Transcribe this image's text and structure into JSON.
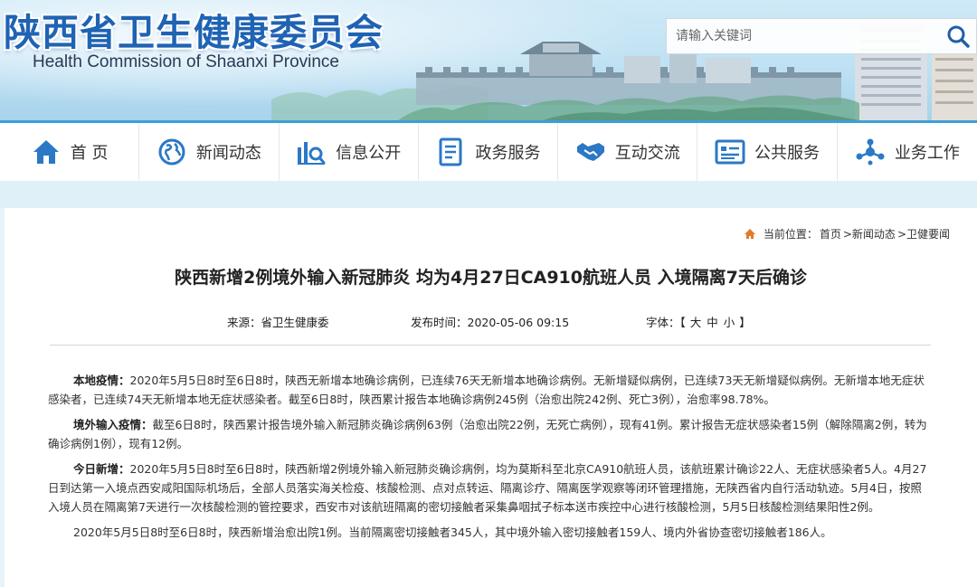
{
  "header": {
    "title_cn": "陕西省卫生健康委员会",
    "title_en": "Health Commission of Shaanxi Province",
    "search_placeholder": "请输入关键词"
  },
  "nav": {
    "items": [
      {
        "label": "首 页",
        "icon": "home-icon"
      },
      {
        "label": "新闻动态",
        "icon": "globe-icon"
      },
      {
        "label": "信息公开",
        "icon": "chart-search-icon"
      },
      {
        "label": "政务服务",
        "icon": "document-icon"
      },
      {
        "label": "互动交流",
        "icon": "handshake-icon"
      },
      {
        "label": "公共服务",
        "icon": "list-card-icon"
      },
      {
        "label": "业务工作",
        "icon": "network-icon"
      }
    ]
  },
  "breadcrumb": {
    "prefix": "当前位置：",
    "items": [
      "首页",
      ">新闻动态",
      ">卫健要闻"
    ]
  },
  "article": {
    "title": "陕西新增2例境外输入新冠肺炎 均为4月27日CA910航班人员 入境隔离7天后确诊",
    "source": "来源：省卫生健康委",
    "publish_time": "发布时间：2020-05-06 09:15",
    "font_label": "字体：【",
    "font_large": "大",
    "font_medium": "中",
    "font_small": "小",
    "font_end": "】",
    "paragraphs": [
      {
        "lead": "本地疫情：",
        "text": "2020年5月5日8时至6日8时，陕西无新增本地确诊病例，已连续76天无新增本地确诊病例。无新增疑似病例，已连续73天无新增疑似病例。无新增本地无症状感染者，已连续74天无新增本地无症状感染者。截至6日8时，陕西累计报告本地确诊病例245例（治愈出院242例、死亡3例），治愈率98.78%。"
      },
      {
        "lead": "境外输入疫情：",
        "text": "截至6日8时，陕西累计报告境外输入新冠肺炎确诊病例63例（治愈出院22例，无死亡病例），现有41例。累计报告无症状感染者15例（解除隔离2例，转为确诊病例1例），现有12例。"
      },
      {
        "lead": "今日新增：",
        "text": "2020年5月5日8时至6日8时，陕西新增2例境外输入新冠肺炎确诊病例，均为莫斯科至北京CA910航班人员，该航班累计确诊22人、无症状感染者5人。4月27日到达第一入境点西安咸阳国际机场后，全部人员落实海关检疫、核酸检测、点对点转运、隔离诊疗、隔离医学观察等闭环管理措施，无陕西省内自行活动轨迹。5月4日，按照入境人员在隔离第7天进行一次核酸检测的管控要求，西安市对该航班隔离的密切接触者采集鼻咽拭子标本送市疾控中心进行核酸检测，5月5日核酸检测结果阳性2例。"
      },
      {
        "lead": "",
        "text": "2020年5月5日8时至6日8时，陕西新增治愈出院1例。当前隔离密切接触者345人，其中境外输入密切接触者159人、境内外省协查密切接触者186人。"
      }
    ]
  },
  "colors": {
    "brand_blue": "#1f63b3",
    "nav_icon_blue": "#2b78c6",
    "accent_line": "#3b9fd8",
    "crumb_home": "#e07b2b"
  }
}
